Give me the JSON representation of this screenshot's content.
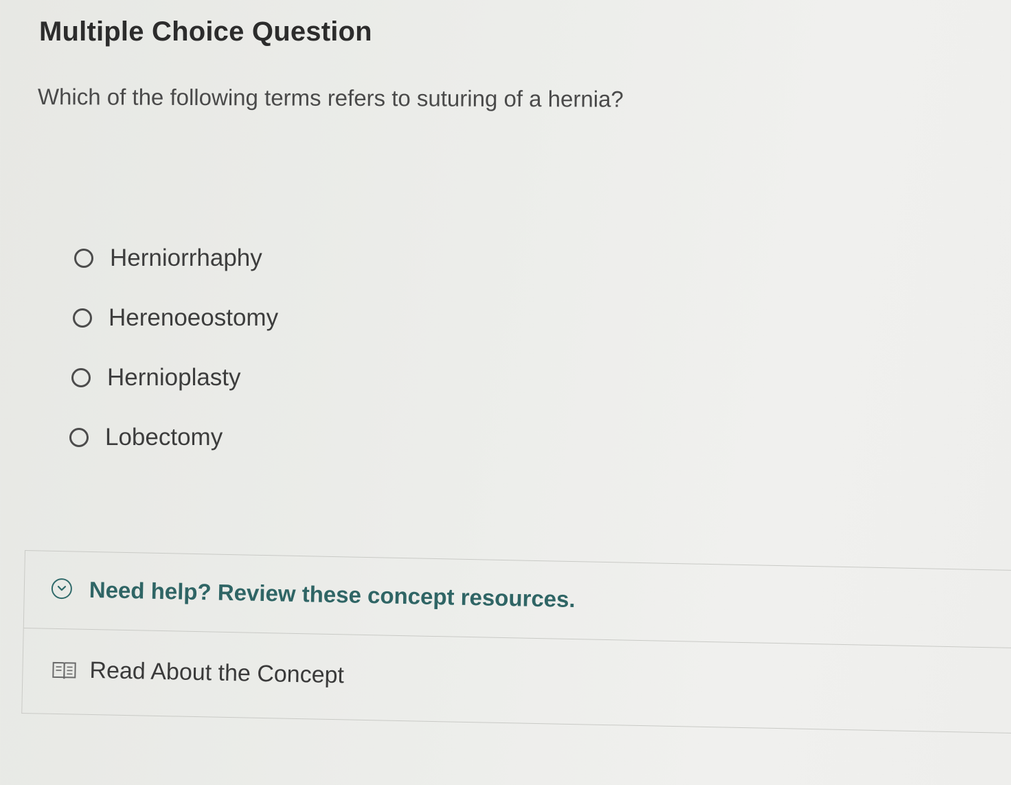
{
  "header": {
    "title": "Multiple Choice Question"
  },
  "question": {
    "text": "Which of the following terms refers to suturing of a hernia?"
  },
  "options": [
    {
      "label": "Herniorrhaphy",
      "selected": false
    },
    {
      "label": "Herenoeostomy",
      "selected": false
    },
    {
      "label": "Hernioplasty",
      "selected": false
    },
    {
      "label": "Lobectomy",
      "selected": false
    }
  ],
  "help": {
    "toggle_icon": "chevron-down-circle-icon",
    "title": "Need help? Review these concept resources.",
    "resources": [
      {
        "icon": "book-icon",
        "label": "Read About the Concept"
      }
    ]
  },
  "colors": {
    "accent": "#2f6565",
    "text": "#3d3d3d",
    "border": "#c9cac6"
  }
}
